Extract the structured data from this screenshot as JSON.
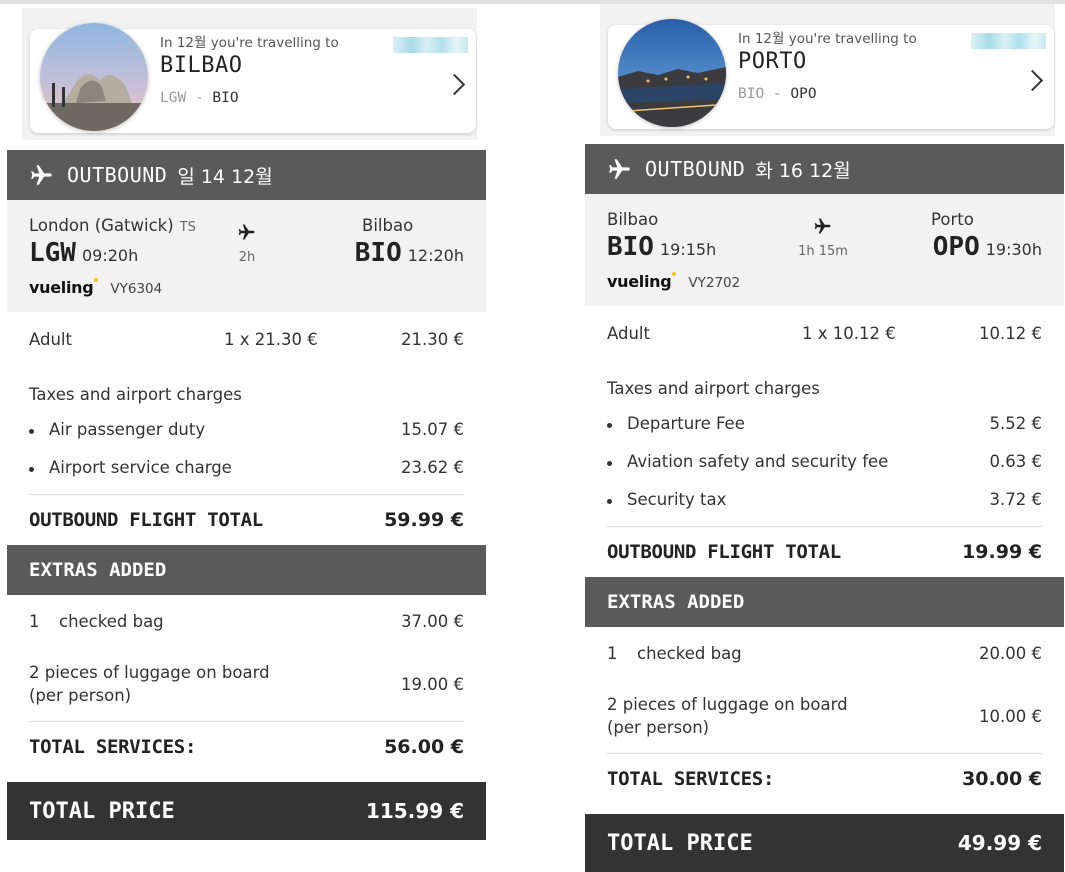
{
  "left": {
    "intro": "In 12월 you're travelling to",
    "city": "BILBAO",
    "from_code": "LGW",
    "to_code": "BIO",
    "bar_title": "OUTBOUND",
    "bar_date": "일 14 12월",
    "origin_name": "London (Gatwick)",
    "origin_terminal": "TS",
    "origin_code": "LGW",
    "origin_time": "09:20h",
    "duration": "2h",
    "dest_name": "Bilbao",
    "dest_code": "BIO",
    "dest_time": "12:20h",
    "airline": "vueling",
    "flight_no": "VY6304",
    "adult_label": "Adult",
    "adult_mult": "1 x 21.30 €",
    "adult_amt": "21.30 €",
    "taxes_label": "Taxes and airport charges",
    "taxes": [
      {
        "label": "Air passenger duty",
        "amt": "15.07 €"
      },
      {
        "label": "Airport service charge",
        "amt": "23.62 €"
      }
    ],
    "flight_total_label": "OUTBOUND FLIGHT TOTAL",
    "flight_total_amt": "59.99 €",
    "extras_label": "EXTRAS ADDED",
    "extra1_qty": "1",
    "extra1_label": "checked bag",
    "extra1_amt": "37.00 €",
    "extra2_label": "2 pieces of luggage on board (per person)",
    "extra2_amt": "19.00 €",
    "services_label": "TOTAL SERVICES:",
    "services_amt": "56.00 €",
    "total_label": "TOTAL PRICE",
    "total_amt": "115.99 €"
  },
  "right": {
    "intro": "In 12월 you're travelling to",
    "city": "PORTO",
    "from_code": "BIO",
    "to_code": "OPO",
    "bar_title": "OUTBOUND",
    "bar_date": "화 16 12월",
    "origin_name": "Bilbao",
    "origin_code": "BIO",
    "origin_time": "19:15h",
    "duration": "1h 15m",
    "dest_name": "Porto",
    "dest_code": "OPO",
    "dest_time": "19:30h",
    "airline": "vueling",
    "flight_no": "VY2702",
    "adult_label": "Adult",
    "adult_mult": "1 x 10.12 €",
    "adult_amt": "10.12 €",
    "taxes_label": "Taxes and airport charges",
    "taxes": [
      {
        "label": "Departure Fee",
        "amt": "5.52 €"
      },
      {
        "label": "Aviation safety and security fee",
        "amt": "0.63 €"
      },
      {
        "label": "Security tax",
        "amt": "3.72 €"
      }
    ],
    "flight_total_label": "OUTBOUND FLIGHT TOTAL",
    "flight_total_amt": "19.99 €",
    "extras_label": "EXTRAS ADDED",
    "extra1_qty": "1",
    "extra1_label": "checked bag",
    "extra1_amt": "20.00 €",
    "extra2_label": "2 pieces of luggage on board (per person)",
    "extra2_amt": "10.00 €",
    "services_label": "TOTAL SERVICES:",
    "services_amt": "30.00 €",
    "total_label": "TOTAL PRICE",
    "total_amt": "49.99 €"
  }
}
